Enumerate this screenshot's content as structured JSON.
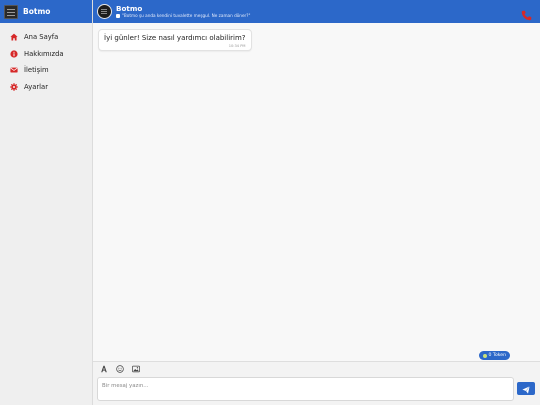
{
  "app": {
    "brand": "Botmo",
    "brand_color": "#2c68c9"
  },
  "sidebar": {
    "title": "Botmo",
    "items": [
      {
        "label": "Ana Sayfa",
        "icon": "home-icon",
        "color": "#d62828"
      },
      {
        "label": "Hakkımızda",
        "icon": "info-icon",
        "color": "#d62828"
      },
      {
        "label": "İletişim",
        "icon": "envelope-icon",
        "color": "#d62828"
      },
      {
        "label": "Ayarlar",
        "icon": "gear-icon",
        "color": "#d62828"
      }
    ]
  },
  "header": {
    "name": "Botmo",
    "status": "\"Botmo şu anda kendini tuvalette meşgul. Ne zaman döner?\"",
    "call_icon": "phone-icon",
    "call_color": "#d62828"
  },
  "messages": [
    {
      "text": "İyi günler! Size nasıl yardımcı olabilirim?",
      "time": "10:34 PM",
      "from": "bot"
    }
  ],
  "token": {
    "label": "0 Token"
  },
  "composer": {
    "placeholder": "Bir mesaj yazın...",
    "tools": [
      "text-format-icon",
      "emoji-icon",
      "image-icon"
    ],
    "send_icon": "send-icon"
  }
}
